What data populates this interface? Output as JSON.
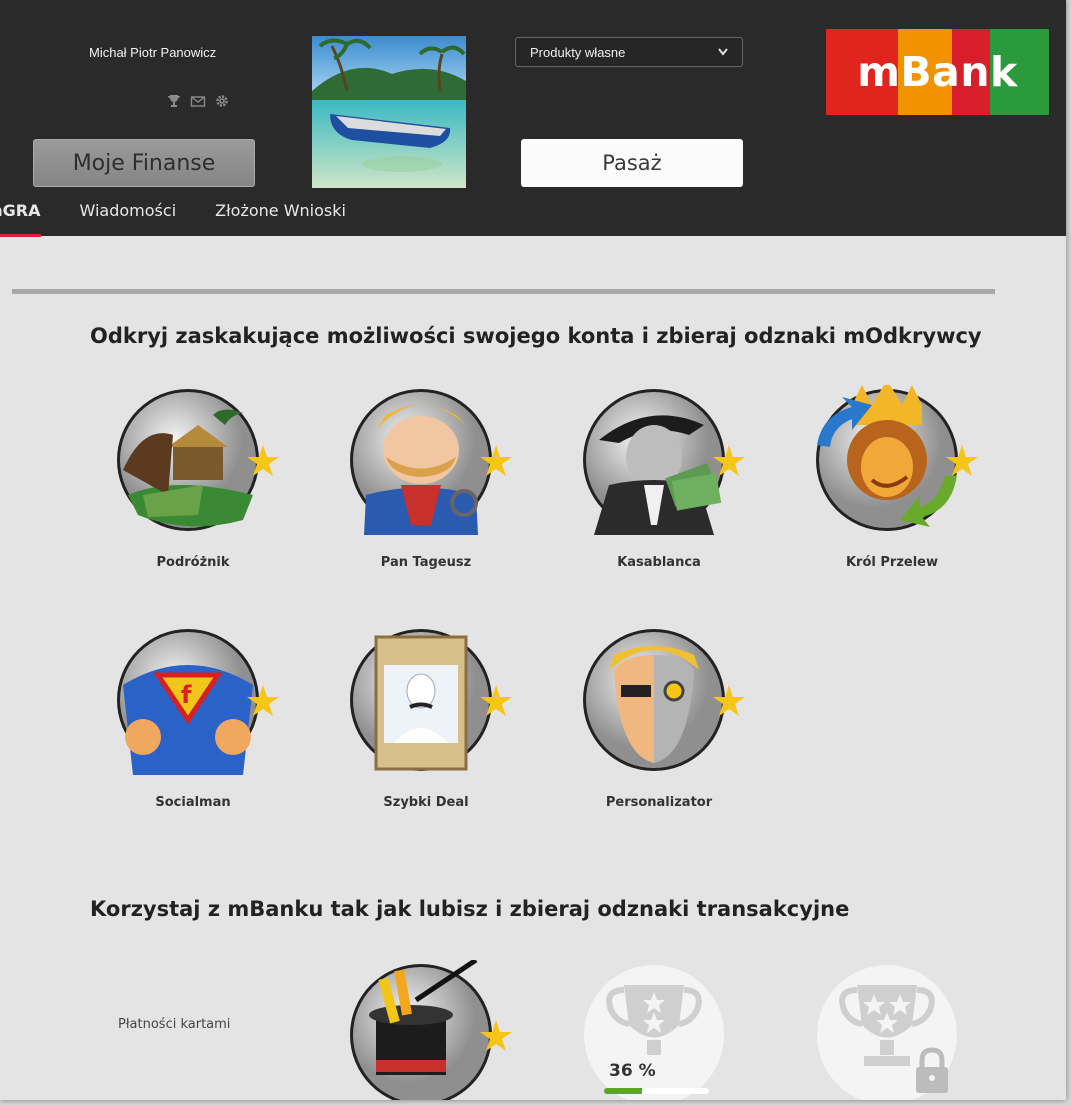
{
  "header": {
    "user_name": "Michał Piotr Panowicz",
    "moje_finanse": "Moje Finanse",
    "product_select": "Produkty własne",
    "pasaz": "Pasaż",
    "logo_text": "mBank",
    "logo_colors": [
      "#e2241f",
      "#f39200",
      "#d81e2a",
      "#2a9a3c"
    ]
  },
  "tabs": [
    {
      "label": "mGRA",
      "active": true
    },
    {
      "label": "Wiadomości",
      "active": false
    },
    {
      "label": "Złożone Wnioski",
      "active": false
    }
  ],
  "section1": {
    "title": "Odkryj zaskakujące możliwości swojego konta i zbieraj odznaki mOdkrywcy",
    "badges": [
      {
        "label": "Podróżnik",
        "icon": "traveler-badge-icon"
      },
      {
        "label": "Pan Tageusz",
        "icon": "pan-tageusz-badge-icon"
      },
      {
        "label": "Kasablanca",
        "icon": "kasablanca-badge-icon"
      },
      {
        "label": "Król Przelew",
        "icon": "krol-przelew-badge-icon"
      },
      {
        "label": "Socialman",
        "icon": "socialman-badge-icon"
      },
      {
        "label": "Szybki Deal",
        "icon": "szybki-deal-badge-icon"
      },
      {
        "label": "Personalizator",
        "icon": "personalizator-badge-icon"
      }
    ]
  },
  "section2": {
    "title": "Korzystaj z mBanku tak jak lubisz i zbieraj odznaki transakcyjne",
    "row_label": "Płatności kartami",
    "progress_text": "36 %",
    "progress_value": 0.36
  }
}
